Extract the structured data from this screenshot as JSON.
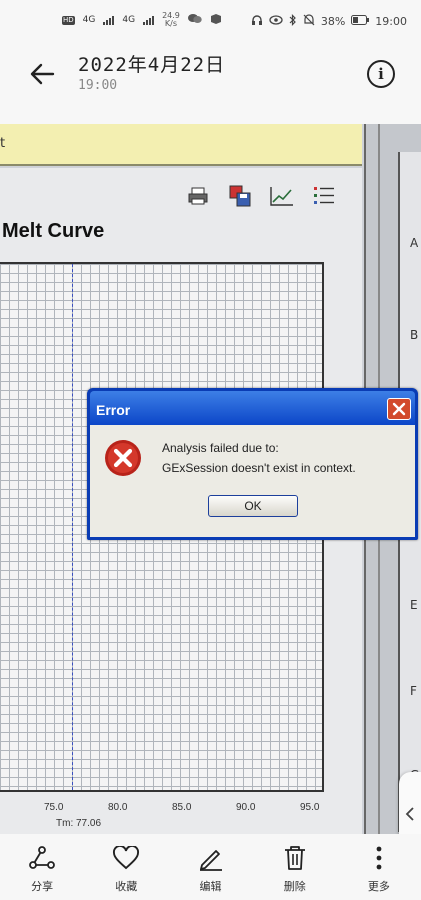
{
  "status_bar": {
    "net_speed": "24.9",
    "net_unit": "K/s",
    "signal_1": "4G",
    "signal_2": "4G",
    "battery": "38%",
    "clock": "19:00"
  },
  "header": {
    "date": "2022年4月22日",
    "time": "19:00"
  },
  "photo": {
    "yellow_bar_text": "t",
    "chart_title": "Melt Curve",
    "x_ticks": [
      "75.0",
      "80.0",
      "85.0",
      "90.0",
      "95.0"
    ],
    "tm_label": "Tm: 77.06",
    "right_rows": [
      "A",
      "B",
      "E",
      "F",
      "G"
    ]
  },
  "dialog": {
    "title": "Error",
    "message_line1": "Analysis failed due to:",
    "message_line2": "GExSession doesn't exist in context.",
    "ok_label": "OK"
  },
  "bottom_bar": {
    "items": [
      {
        "label": "分享",
        "icon": "share-icon"
      },
      {
        "label": "收藏",
        "icon": "heart-icon"
      },
      {
        "label": "编辑",
        "icon": "pencil-icon"
      },
      {
        "label": "删除",
        "icon": "trash-icon"
      },
      {
        "label": "更多",
        "icon": "more-icon"
      }
    ]
  },
  "colors": {
    "dialog_frame": "#0a3cb4",
    "close_button": "#d24a2c",
    "yellow_bar": "#f3efb1",
    "tm_line": "#3a4fc0"
  }
}
